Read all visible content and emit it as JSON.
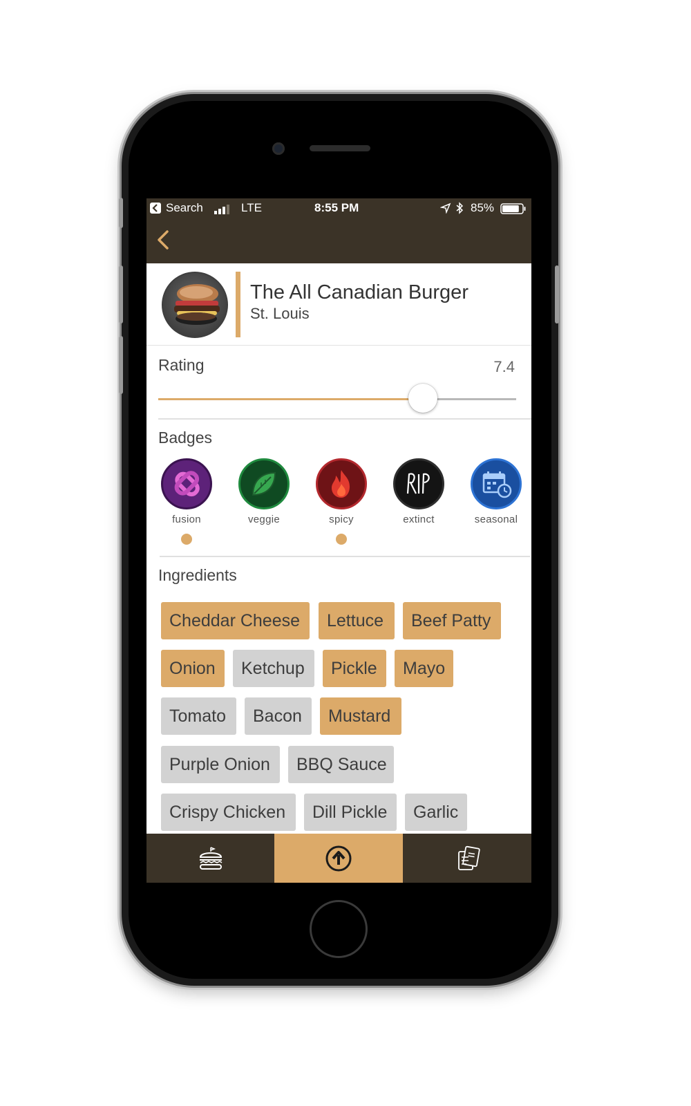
{
  "status_bar": {
    "back_app": "Search",
    "network": "LTE",
    "time": "8:55 PM",
    "battery": "85%",
    "battery_level": 0.85
  },
  "burger": {
    "name": "The All Canadian Burger",
    "city": "St. Louis"
  },
  "rating": {
    "label": "Rating",
    "value": "7.4",
    "value_num": 7.4,
    "max": 10
  },
  "badges": {
    "label": "Badges",
    "items": [
      {
        "label": "fusion",
        "selected": true,
        "icon": "fusion-icon",
        "color": "#6b2d86"
      },
      {
        "label": "veggie",
        "selected": false,
        "icon": "leaf-icon",
        "color": "#1f7a3a"
      },
      {
        "label": "spicy",
        "selected": true,
        "icon": "flame-icon",
        "color": "#9e1f24"
      },
      {
        "label": "extinct",
        "selected": false,
        "icon": "rip-icon",
        "color": "#1a1a1a"
      },
      {
        "label": "seasonal",
        "selected": false,
        "icon": "calendar-icon",
        "color": "#1c5cb0"
      }
    ]
  },
  "ingredients": {
    "label": "Ingredients",
    "items": [
      {
        "name": "Cheddar Cheese",
        "selected": true
      },
      {
        "name": "Lettuce",
        "selected": true
      },
      {
        "name": "Beef Patty",
        "selected": true
      },
      {
        "name": "Onion",
        "selected": true
      },
      {
        "name": "Ketchup",
        "selected": false
      },
      {
        "name": "Pickle",
        "selected": true
      },
      {
        "name": "Mayo",
        "selected": true
      },
      {
        "name": "Tomato",
        "selected": false
      },
      {
        "name": "Bacon",
        "selected": false
      },
      {
        "name": "Mustard",
        "selected": true
      },
      {
        "name": "Purple Onion",
        "selected": false
      },
      {
        "name": "BBQ Sauce",
        "selected": false
      },
      {
        "name": "Crispy Chicken",
        "selected": false
      },
      {
        "name": "Dill Pickle",
        "selected": false
      },
      {
        "name": "Garlic",
        "selected": false
      }
    ]
  },
  "tabs": [
    {
      "icon": "burger-icon",
      "active": false
    },
    {
      "icon": "upload-icon",
      "active": true
    },
    {
      "icon": "menu-card-icon",
      "active": false
    }
  ],
  "colors": {
    "accent": "#dcaa69",
    "nav_bg": "#3b3327",
    "chip_off": "#d2d2d2"
  }
}
